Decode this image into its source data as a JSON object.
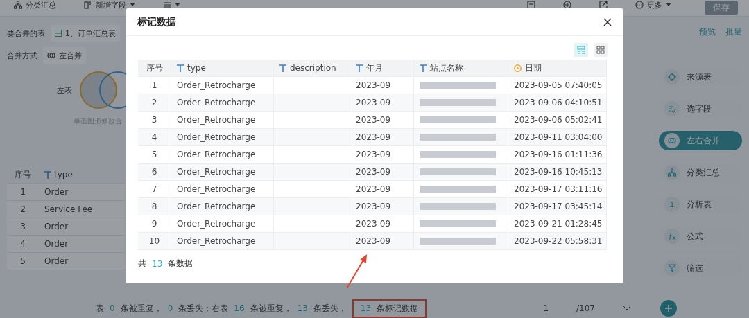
{
  "toolbar": {
    "left": [
      {
        "label": "分类汇总",
        "kind": "tree"
      },
      {
        "label": "新增字段",
        "kind": "field",
        "caret": true
      },
      {
        "kind": "list",
        "caret": true
      }
    ],
    "right": [
      {
        "kind": "param"
      },
      {
        "kind": "chart"
      },
      {
        "kind": "export"
      },
      {
        "label": "更多",
        "kind": "more",
        "caret": true
      }
    ],
    "save": {
      "label": "保存",
      "disabled": true
    }
  },
  "merge": {
    "table_label": "要合并的表",
    "table_value": "1、订单汇总表",
    "mode_label": "合并方式",
    "mode_value": "左合并",
    "venn_label": "左表",
    "hint": "单击图形修改合"
  },
  "grid": {
    "columns": [
      "序号",
      "type"
    ],
    "rows": [
      [
        "1",
        "Order"
      ],
      [
        "2",
        "Service Fee"
      ],
      [
        "3",
        "Order"
      ],
      [
        "4",
        "Order"
      ],
      [
        "5",
        "Order"
      ]
    ]
  },
  "status_bar": {
    "parts": [
      {
        "text": "表"
      },
      {
        "text": "0",
        "kind": "count"
      },
      {
        "text": "条被重复，"
      },
      {
        "text": "0",
        "kind": "count"
      },
      {
        "text": "条丢失；右表"
      },
      {
        "text": "16",
        "kind": "link"
      },
      {
        "text": "条被重复，"
      },
      {
        "text": "13",
        "kind": "link"
      },
      {
        "text": "条丢失，"
      },
      {
        "text": "13",
        "kind": "link"
      },
      {
        "text": "条标记数据"
      }
    ],
    "page": "1",
    "pages": "/107"
  },
  "side_links": [
    "预览",
    "批量"
  ],
  "flow": [
    {
      "label": "来源表",
      "kind": "source",
      "selected": false
    },
    {
      "label": "选字段",
      "kind": "fields",
      "selected": false
    },
    {
      "label": "左右合并",
      "kind": "merge",
      "selected": true
    },
    {
      "label": "分类汇总",
      "kind": "tree",
      "selected": false
    },
    {
      "label": "分析表",
      "badge": "1",
      "kind": "badge",
      "selected": false
    },
    {
      "label": "公式",
      "kind": "fx",
      "selected": false
    },
    {
      "label": "筛选",
      "kind": "filter",
      "selected": false
    }
  ],
  "modal": {
    "title": "标记数据",
    "views": [
      {
        "kind": "rows",
        "selected": true
      },
      {
        "kind": "grid",
        "selected": false
      }
    ],
    "columns": [
      {
        "label": "序号",
        "kind": "none"
      },
      {
        "label": "type",
        "kind": "text"
      },
      {
        "label": "description",
        "kind": "text"
      },
      {
        "label": "年月",
        "kind": "text"
      },
      {
        "label": "站点名称",
        "kind": "text"
      },
      {
        "label": "日期",
        "kind": "date"
      }
    ],
    "rows": [
      [
        "1",
        "Order_Retrocharge",
        "",
        "2023-09",
        "",
        "2023-09-05 07:40:05"
      ],
      [
        "2",
        "Order_Retrocharge",
        "",
        "2023-09",
        "",
        "2023-09-06 04:10:51"
      ],
      [
        "3",
        "Order_Retrocharge",
        "",
        "2023-09",
        "",
        "2023-09-06 05:02:41"
      ],
      [
        "4",
        "Order_Retrocharge",
        "",
        "2023-09",
        "",
        "2023-09-11 03:04:00"
      ],
      [
        "5",
        "Order_Retrocharge",
        "",
        "2023-09",
        "",
        "2023-09-16 01:11:36"
      ],
      [
        "6",
        "Order_Retrocharge",
        "",
        "2023-09",
        "",
        "2023-09-16 10:45:13"
      ],
      [
        "7",
        "Order_Retrocharge",
        "",
        "2023-09",
        "",
        "2023-09-17 03:11:16"
      ],
      [
        "8",
        "Order_Retrocharge",
        "",
        "2023-09",
        "",
        "2023-09-17 03:45:14"
      ],
      [
        "9",
        "Order_Retrocharge",
        "",
        "2023-09",
        "",
        "2023-09-21 01:28:45"
      ],
      [
        "10",
        "Order_Retrocharge",
        "",
        "2023-09",
        "",
        "2023-09-22 05:58:31"
      ]
    ],
    "footer": {
      "prefix": "共",
      "count": "13",
      "suffix": "条数据"
    }
  }
}
